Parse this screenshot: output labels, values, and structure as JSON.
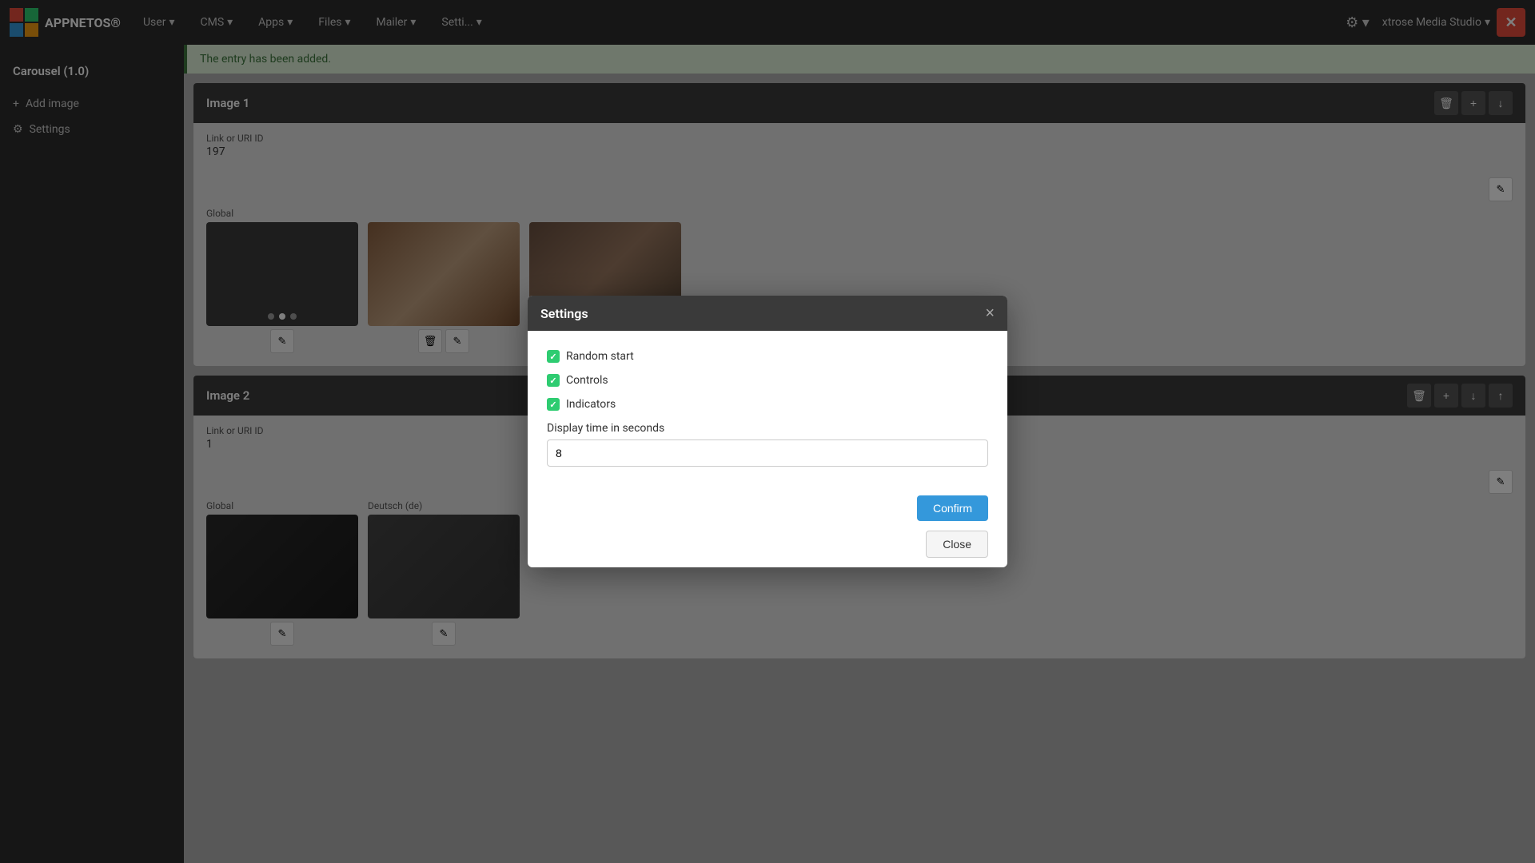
{
  "app": {
    "brand": "APPNETOS®",
    "page_title": "Carousel (1.0)"
  },
  "navbar": {
    "items": [
      {
        "label": "User",
        "id": "user"
      },
      {
        "label": "CMS",
        "id": "cms"
      },
      {
        "label": "Apps",
        "id": "apps"
      },
      {
        "label": "Files",
        "id": "files"
      },
      {
        "label": "Mailer",
        "id": "mailer"
      },
      {
        "label": "Setti...",
        "id": "settings"
      }
    ],
    "gear_label": "⚙",
    "studio_label": "xtrose Media Studio",
    "x_label": "✕"
  },
  "sidebar": {
    "title": "Carousel (1.0)",
    "items": [
      {
        "label": "Add image",
        "icon": "+",
        "id": "add-image"
      },
      {
        "label": "Settings",
        "icon": "⚙",
        "id": "settings"
      }
    ]
  },
  "alert": {
    "message": "The entry has been added."
  },
  "image_cards": [
    {
      "id": "image-1",
      "title": "Image 1",
      "link_label": "Link or URI ID",
      "link_value": "197",
      "global_label": "Global",
      "edit_btn_visible": true,
      "images": [
        {
          "label": "Global",
          "color": "#3a3a3a",
          "has_dots": true,
          "dot_count": 3,
          "active_dot": 1
        },
        {
          "label": "",
          "color": "#7a5540",
          "has_dots": false
        },
        {
          "label": "",
          "color": "#5a4a3a",
          "has_dots": false
        }
      ]
    },
    {
      "id": "image-2",
      "title": "Image 2",
      "link_label": "Link or URI ID",
      "link_value": "1",
      "global_label": "Global",
      "deutsch_label": "Deutsch (de)",
      "edit_btn_visible": true,
      "images": [
        {
          "label": "Global",
          "color": "#2a2a2a"
        },
        {
          "label": "Deutsch (de)",
          "color": "#4a4a4a"
        }
      ]
    }
  ],
  "modal": {
    "title": "Settings",
    "close_label": "×",
    "checkboxes": [
      {
        "label": "Random start",
        "checked": true,
        "id": "random-start"
      },
      {
        "label": "Controls",
        "checked": true,
        "id": "controls"
      },
      {
        "label": "Indicators",
        "checked": true,
        "id": "indicators"
      }
    ],
    "display_time_label": "Display time in seconds",
    "display_time_value": "8",
    "confirm_label": "Confirm",
    "close_btn_label": "Close"
  },
  "buttons": {
    "delete_icon": "🗑",
    "up_icon": "↑",
    "down_icon": "↓",
    "plus_icon": "+",
    "edit_icon": "✎"
  }
}
